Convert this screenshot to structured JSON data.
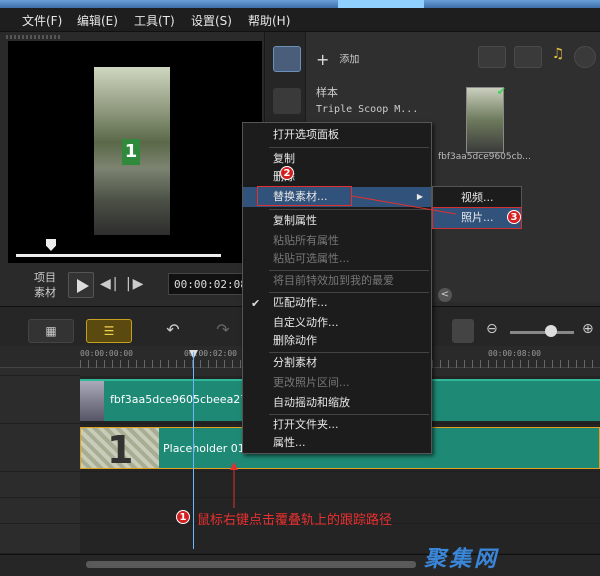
{
  "menu": [
    "文件(F)",
    "编辑(E)",
    "工具(T)",
    "设置(S)",
    "帮助(H)"
  ],
  "preview": {
    "mode_labels": [
      "项目",
      "素材"
    ],
    "timecode": "00:00:02:08",
    "frame_sign": "1"
  },
  "library": {
    "add_label": "添加",
    "list_items": [
      "样本",
      "Triple Scoop M..."
    ],
    "thumb_label": "fbf3aa5dce9605cb...",
    "scroll_left": "<"
  },
  "timeline": {
    "ruler_labels": [
      "00:00:00:00",
      "00:00:02:00",
      "00:00:08:00"
    ],
    "clip1_label": "fbf3aa5dce9605cbeea27b",
    "clip2_number": "1",
    "clip2_label": "Placeholder 01.jpg"
  },
  "context_menu": {
    "items": [
      {
        "label": "打开选项面板",
        "state": "normal"
      },
      {
        "label": "复制",
        "state": "normal"
      },
      {
        "label": "删除",
        "state": "normal"
      },
      {
        "label": "替换素材...",
        "state": "highlight"
      },
      {
        "label": "复制属性",
        "state": "normal"
      },
      {
        "label": "粘贴所有属性",
        "state": "disabled"
      },
      {
        "label": "粘贴可选属性...",
        "state": "disabled"
      },
      {
        "label": "将目前特效加到我的最爱",
        "state": "disabled"
      },
      {
        "label": "匹配动作...",
        "state": "checked"
      },
      {
        "label": "自定义动作...",
        "state": "normal"
      },
      {
        "label": "删除动作",
        "state": "normal"
      },
      {
        "label": "分割素材",
        "state": "normal"
      },
      {
        "label": "更改照片区间...",
        "state": "disabled"
      },
      {
        "label": "自动摇动和缩放",
        "state": "normal"
      },
      {
        "label": "打开文件夹...",
        "state": "normal"
      },
      {
        "label": "属性...",
        "state": "normal"
      }
    ],
    "check_mark": "✔",
    "submenu_arrow": "▶"
  },
  "submenu": {
    "items": [
      "视频...",
      "照片..."
    ]
  },
  "annotations": {
    "badges": [
      "1",
      "2",
      "3"
    ],
    "note": "鼠标右键点击覆叠轨上的跟踪路径",
    "watermark": "聚集网"
  },
  "colors": {
    "accent_red": "#e03030",
    "clip_teal": "#1e8a76",
    "highlight_blue": "#31527a"
  }
}
